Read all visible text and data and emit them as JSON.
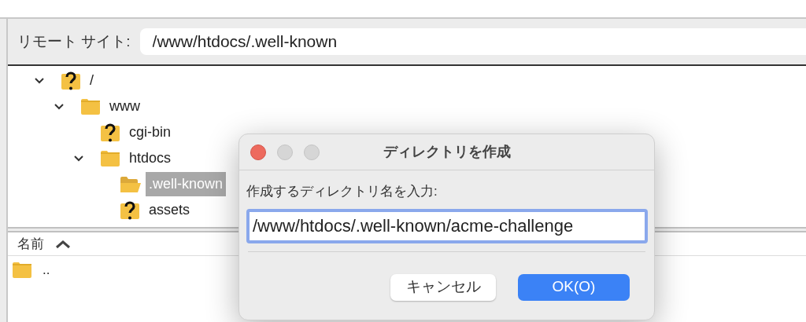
{
  "remote_site": {
    "label": "リモート サイト:",
    "path": "/www/htdocs/.well-known"
  },
  "tree": [
    {
      "name": "/",
      "kind": "unknown",
      "expanded": true,
      "selected": false,
      "children": [
        {
          "name": "www",
          "kind": "folder",
          "expanded": true,
          "selected": false,
          "children": [
            {
              "name": "cgi-bin",
              "kind": "unknown",
              "expanded": false,
              "selected": false
            },
            {
              "name": "htdocs",
              "kind": "folder",
              "expanded": true,
              "selected": false,
              "children": [
                {
                  "name": ".well-known",
                  "kind": "open-folder",
                  "expanded": false,
                  "selected": true
                },
                {
                  "name": "assets",
                  "kind": "unknown",
                  "expanded": false,
                  "selected": false
                }
              ]
            }
          ]
        }
      ]
    }
  ],
  "file_list": {
    "columns": [
      {
        "label": "名前",
        "sorted_ascending": true
      }
    ],
    "rows": [
      {
        "name": ".."
      }
    ]
  },
  "dialog": {
    "title": "ディレクトリを作成",
    "prompt": "作成するディレクトリ名を入力:",
    "value": "/www/htdocs/.well-known/acme-challenge",
    "buttons": [
      {
        "label": "キャンセル",
        "kind": "secondary"
      },
      {
        "label": "OK(O)",
        "kind": "primary"
      }
    ]
  }
}
